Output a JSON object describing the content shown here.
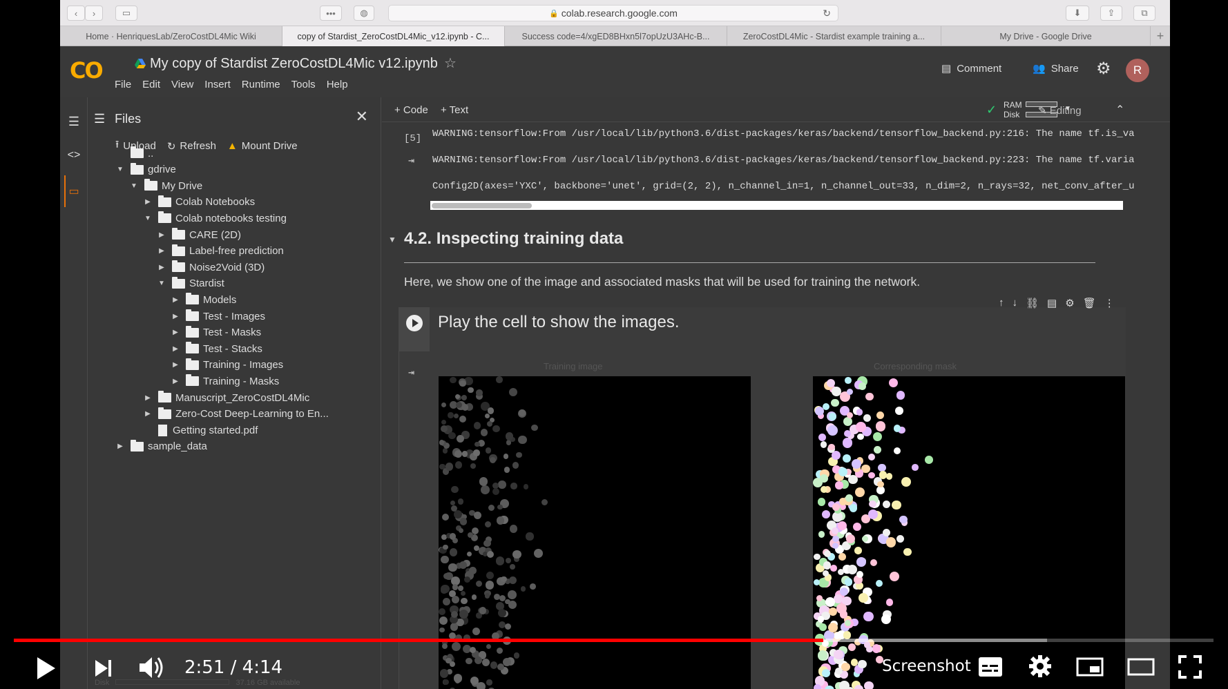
{
  "browser": {
    "url": "colab.research.google.com",
    "tabs": [
      "Home · HenriquesLab/ZeroCostDL4Mic Wiki",
      "copy of Stardist_ZeroCostDL4Mic_v12.ipynb - C...",
      "Success code=4/xgED8BHxn5l7opUzU3AHc-B...",
      "ZeroCostDL4Mic - Stardist example training a...",
      "My Drive - Google Drive"
    ],
    "active_tab": 1
  },
  "colab": {
    "logo": "CO",
    "title": "My copy of Stardist  ZeroCostDL4Mic  v12.ipynb",
    "menu": [
      "File",
      "Edit",
      "View",
      "Insert",
      "Runtime",
      "Tools",
      "Help"
    ],
    "comment_label": "Comment",
    "share_label": "Share",
    "avatar_letter": "R",
    "add_code_label": "+ Code",
    "add_text_label": "+ Text",
    "ram_label": "RAM",
    "disk_label": "Disk",
    "editing_label": "Editing",
    "accent_color": "#f9ab00"
  },
  "files": {
    "title": "Files",
    "upload_label": "Upload",
    "refresh_label": "Refresh",
    "mount_label": "Mount Drive",
    "tree": [
      {
        "label": "..",
        "depth": 0,
        "type": "up"
      },
      {
        "label": "gdrive",
        "depth": 0,
        "type": "folder",
        "expanded": true
      },
      {
        "label": "My Drive",
        "depth": 1,
        "type": "folder",
        "expanded": true
      },
      {
        "label": "Colab Notebooks",
        "depth": 2,
        "type": "folder",
        "expanded": false
      },
      {
        "label": "Colab notebooks testing",
        "depth": 2,
        "type": "folder",
        "expanded": true
      },
      {
        "label": "CARE (2D)",
        "depth": 3,
        "type": "folder",
        "expanded": false
      },
      {
        "label": "Label-free prediction",
        "depth": 3,
        "type": "folder",
        "expanded": false
      },
      {
        "label": "Noise2Void (3D)",
        "depth": 3,
        "type": "folder",
        "expanded": false
      },
      {
        "label": "Stardist",
        "depth": 3,
        "type": "folder",
        "expanded": true
      },
      {
        "label": "Models",
        "depth": 4,
        "type": "folder",
        "expanded": false
      },
      {
        "label": "Test - Images",
        "depth": 4,
        "type": "folder",
        "expanded": false
      },
      {
        "label": "Test - Masks",
        "depth": 4,
        "type": "folder",
        "expanded": false
      },
      {
        "label": "Test - Stacks",
        "depth": 4,
        "type": "folder",
        "expanded": false
      },
      {
        "label": "Training - Images",
        "depth": 4,
        "type": "folder",
        "expanded": false
      },
      {
        "label": "Training - Masks",
        "depth": 4,
        "type": "folder",
        "expanded": false
      },
      {
        "label": "Manuscript_ZeroCostDL4Mic",
        "depth": 2,
        "type": "folder",
        "expanded": false
      },
      {
        "label": "Zero-Cost Deep-Learning to En...",
        "depth": 2,
        "type": "folder",
        "expanded": false
      },
      {
        "label": "Getting started.pdf",
        "depth": 2,
        "type": "file"
      },
      {
        "label": "sample_data",
        "depth": 0,
        "type": "folder",
        "expanded": false
      }
    ]
  },
  "notebook": {
    "exec_count": "[5]",
    "output_lines": [
      "WARNING:tensorflow:From /usr/local/lib/python3.6/dist-packages/keras/backend/tensorflow_backend.py:216: The name tf.is_va",
      "WARNING:tensorflow:From /usr/local/lib/python3.6/dist-packages/keras/backend/tensorflow_backend.py:223: The name tf.varia",
      "Config2D(axes='YXC', backbone='unet', grid=(2, 2), n_channel_in=1, n_channel_out=33, n_dim=2, n_rays=32, net_conv_after_u"
    ],
    "section_title": "4.2. Inspecting training data",
    "section_desc": "Here, we show one of the image and associated masks that will be used for training the network.",
    "cell_title": "Play the cell to show the images.",
    "image_label_1": "Training image",
    "image_label_2": "Corresponding mask"
  },
  "player": {
    "time": "2:51 / 4:14",
    "played_fraction": 0.675,
    "buffered_fraction": 0.861,
    "screenshot_label": "Screenshot",
    "disk_text": "37.16 GB available",
    "disk_label": "Disk",
    "progress_color": "#ff0000"
  }
}
